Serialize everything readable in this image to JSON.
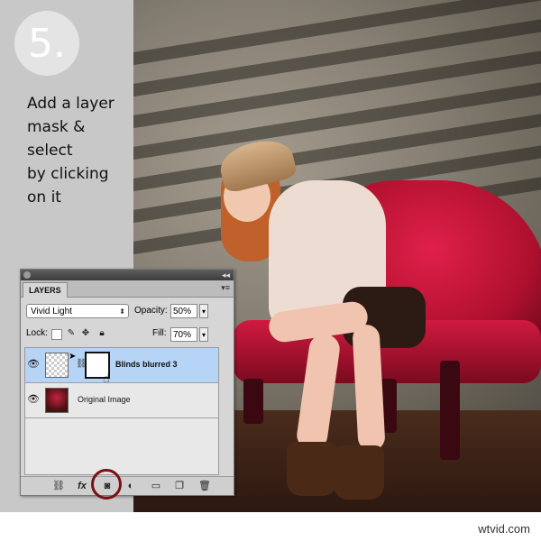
{
  "step": {
    "number": "5."
  },
  "caption": {
    "lines": [
      "Add a layer",
      "mask & select",
      "by clicking",
      "on it"
    ]
  },
  "watermark": "wtvid.com",
  "panel": {
    "tab_label": "LAYERS",
    "blend_mode": "Vivid Light",
    "opacity_label": "Opacity:",
    "opacity_value": "50%",
    "lock_label": "Lock:",
    "fill_label": "Fill:",
    "fill_value": "70%",
    "layers": [
      {
        "name": "Blinds blurred 3",
        "selected": true,
        "visible": true,
        "has_mask": true
      },
      {
        "name": "Original Image",
        "selected": false,
        "visible": true,
        "has_mask": false
      }
    ],
    "bottom_icons": [
      "link-layers-icon",
      "fx-icon",
      "add-mask-icon",
      "adjustment-layer-icon",
      "new-group-icon",
      "new-layer-icon",
      "trash-icon"
    ],
    "fx_label": "fx"
  },
  "colors": {
    "highlight_ring": "#7a1014",
    "selected_row": "#b6d4f6",
    "strip": "#c8c8c8"
  }
}
